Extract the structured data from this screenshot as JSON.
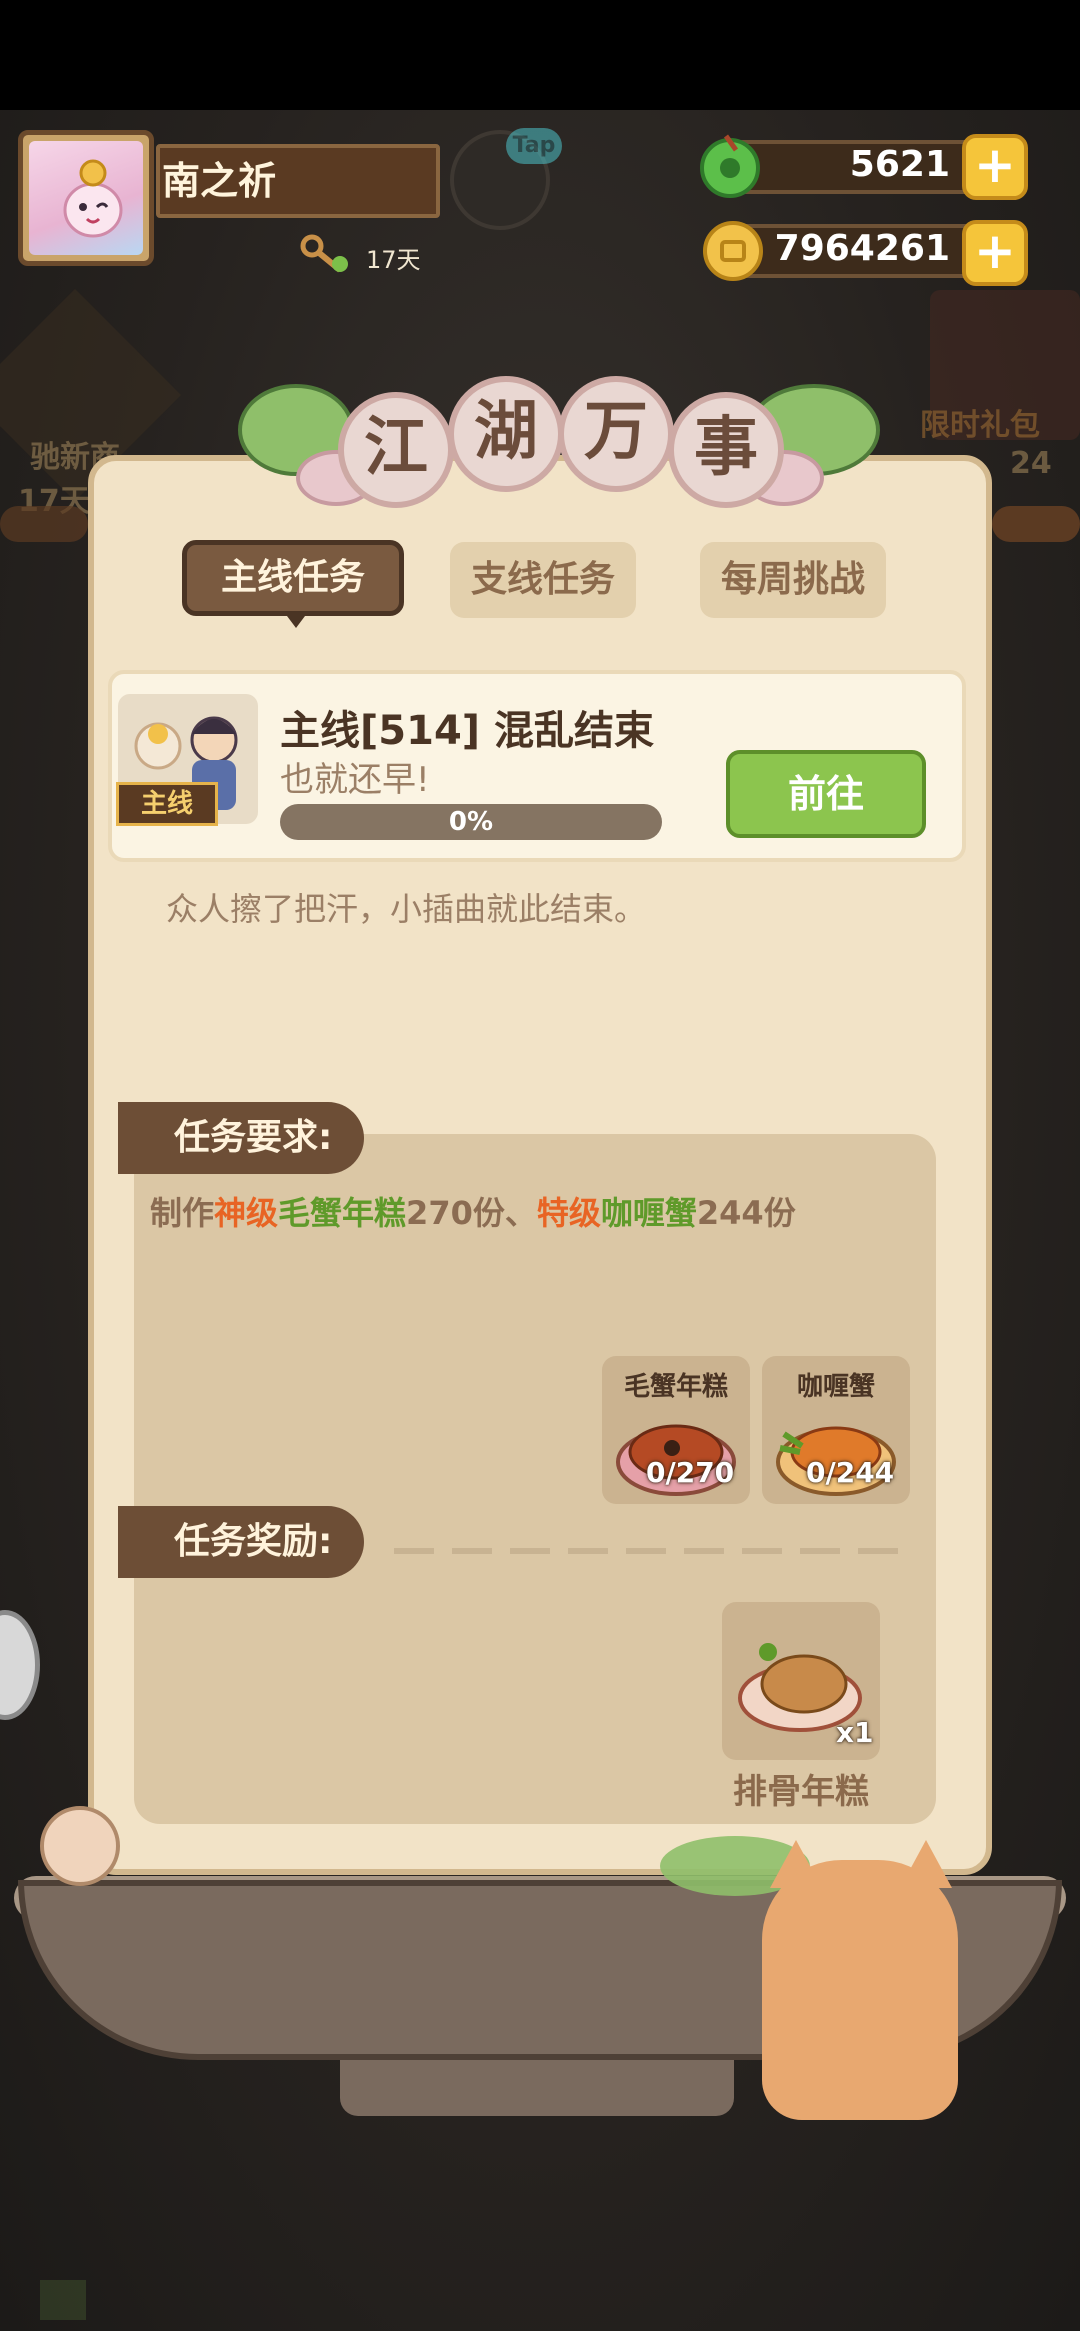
{
  "player": {
    "name": "南之祈",
    "days": "17天",
    "tap_badge": "Tap"
  },
  "resources": {
    "gems": "5621",
    "coins": "7964261",
    "plus": "+"
  },
  "background": {
    "left_label": "驰新商",
    "left_sub": "17天",
    "right_label": "限时礼包",
    "right_sub": "24"
  },
  "panel": {
    "title_chars": [
      "江",
      "湖",
      "万",
      "事"
    ],
    "tabs": [
      {
        "label": "主线任务",
        "active": true
      },
      {
        "label": "支线任务",
        "active": false
      },
      {
        "label": "每周挑战",
        "active": false
      }
    ],
    "quest": {
      "tag": "主线",
      "title": "主线[514] 混乱结束",
      "subtitle": "也就还早!",
      "progress_text": "0%",
      "progress": 0,
      "go_label": "前往",
      "description": "众人擦了把汗，小插曲就此结束。"
    },
    "requirements": {
      "label": "任务要求:",
      "text_parts": [
        {
          "text": "制作",
          "color": "normal"
        },
        {
          "text": "神级",
          "color": "orange"
        },
        {
          "text": "毛蟹年糕",
          "color": "green"
        },
        {
          "text": "270份、",
          "color": "normal"
        },
        {
          "text": "特级",
          "color": "orange"
        },
        {
          "text": "咖喱蟹",
          "color": "green"
        },
        {
          "text": "244份",
          "color": "normal"
        }
      ],
      "items": [
        {
          "name": "毛蟹年糕",
          "count": "0/270"
        },
        {
          "name": "咖喱蟹",
          "count": "0/244"
        }
      ]
    },
    "rewards": {
      "label": "任务奖励:",
      "item": {
        "name": "排骨年糕",
        "count": "x1"
      }
    }
  },
  "colors": {
    "panel_bg": "#f2e3c7",
    "tab_active": "#7a5a40",
    "go_button": "#8cc54e",
    "orange_text": "#e86424",
    "green_text": "#5f9a2a"
  }
}
